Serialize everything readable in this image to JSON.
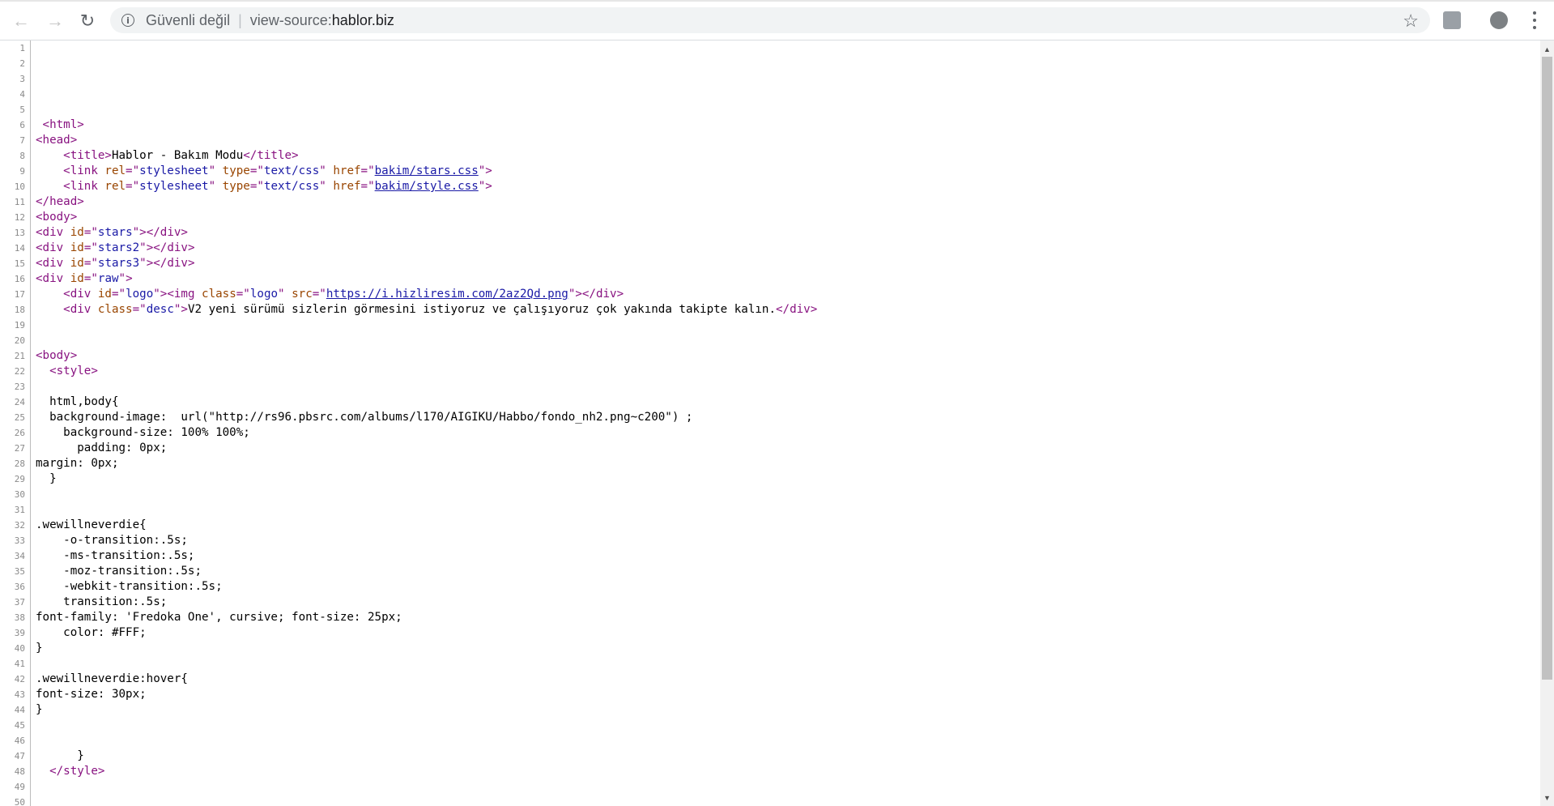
{
  "browser": {
    "security_label": "Güvenli değil",
    "separator": "|",
    "url_scheme": "view-source:",
    "url_host": "hablor.biz",
    "icons": {
      "back": "arrow-left-icon",
      "forward": "arrow-right-icon",
      "reload": "reload-icon",
      "info": "info-icon",
      "bookmark": "star-icon",
      "extension1": "extension-icon",
      "extension2": "profile-icon",
      "menu": "kebab-menu-icon"
    }
  },
  "source_lines": [
    [],
    [],
    [],
    [],
    [],
    [
      {
        "t": " "
      },
      {
        "c": "tag",
        "t": "<html>"
      }
    ],
    [
      {
        "c": "tag",
        "t": "<head>"
      }
    ],
    [
      {
        "t": "    "
      },
      {
        "c": "tag",
        "t": "<title>"
      },
      {
        "t": "Hablor - Bakım Modu"
      },
      {
        "c": "tag",
        "t": "</title>"
      }
    ],
    [
      {
        "t": "    "
      },
      {
        "c": "tag",
        "t": "<link "
      },
      {
        "c": "attr",
        "t": "rel"
      },
      {
        "c": "tag",
        "t": "=\""
      },
      {
        "c": "val",
        "t": "stylesheet"
      },
      {
        "c": "tag",
        "t": "\" "
      },
      {
        "c": "attr",
        "t": "type"
      },
      {
        "c": "tag",
        "t": "=\""
      },
      {
        "c": "val",
        "t": "text/css"
      },
      {
        "c": "tag",
        "t": "\" "
      },
      {
        "c": "attr",
        "t": "href"
      },
      {
        "c": "tag",
        "t": "=\""
      },
      {
        "c": "link",
        "t": "bakim/stars.css"
      },
      {
        "c": "tag",
        "t": "\">"
      }
    ],
    [
      {
        "t": "    "
      },
      {
        "c": "tag",
        "t": "<link "
      },
      {
        "c": "attr",
        "t": "rel"
      },
      {
        "c": "tag",
        "t": "=\""
      },
      {
        "c": "val",
        "t": "stylesheet"
      },
      {
        "c": "tag",
        "t": "\" "
      },
      {
        "c": "attr",
        "t": "type"
      },
      {
        "c": "tag",
        "t": "=\""
      },
      {
        "c": "val",
        "t": "text/css"
      },
      {
        "c": "tag",
        "t": "\" "
      },
      {
        "c": "attr",
        "t": "href"
      },
      {
        "c": "tag",
        "t": "=\""
      },
      {
        "c": "link",
        "t": "bakim/style.css"
      },
      {
        "c": "tag",
        "t": "\">"
      }
    ],
    [
      {
        "c": "tag",
        "t": "</head>"
      }
    ],
    [
      {
        "c": "tag",
        "t": "<body>"
      }
    ],
    [
      {
        "c": "tag",
        "t": "<div "
      },
      {
        "c": "attr",
        "t": "id"
      },
      {
        "c": "tag",
        "t": "=\""
      },
      {
        "c": "val",
        "t": "stars"
      },
      {
        "c": "tag",
        "t": "\"></div>"
      }
    ],
    [
      {
        "c": "tag",
        "t": "<div "
      },
      {
        "c": "attr",
        "t": "id"
      },
      {
        "c": "tag",
        "t": "=\""
      },
      {
        "c": "val",
        "t": "stars2"
      },
      {
        "c": "tag",
        "t": "\"></div>"
      }
    ],
    [
      {
        "c": "tag",
        "t": "<div "
      },
      {
        "c": "attr",
        "t": "id"
      },
      {
        "c": "tag",
        "t": "=\""
      },
      {
        "c": "val",
        "t": "stars3"
      },
      {
        "c": "tag",
        "t": "\"></div>"
      }
    ],
    [
      {
        "c": "tag",
        "t": "<div "
      },
      {
        "c": "attr",
        "t": "id"
      },
      {
        "c": "tag",
        "t": "=\""
      },
      {
        "c": "val",
        "t": "raw"
      },
      {
        "c": "tag",
        "t": "\">"
      }
    ],
    [
      {
        "t": "    "
      },
      {
        "c": "tag",
        "t": "<div "
      },
      {
        "c": "attr",
        "t": "id"
      },
      {
        "c": "tag",
        "t": "=\""
      },
      {
        "c": "val",
        "t": "logo"
      },
      {
        "c": "tag",
        "t": "\"><img "
      },
      {
        "c": "attr",
        "t": "class"
      },
      {
        "c": "tag",
        "t": "=\""
      },
      {
        "c": "val",
        "t": "logo"
      },
      {
        "c": "tag",
        "t": "\" "
      },
      {
        "c": "attr",
        "t": "src"
      },
      {
        "c": "tag",
        "t": "=\""
      },
      {
        "c": "link",
        "t": "https://i.hizliresim.com/2az2Qd.png"
      },
      {
        "c": "tag",
        "t": "\"></div>"
      }
    ],
    [
      {
        "t": "    "
      },
      {
        "c": "tag",
        "t": "<div "
      },
      {
        "c": "attr",
        "t": "class"
      },
      {
        "c": "tag",
        "t": "=\""
      },
      {
        "c": "val",
        "t": "desc"
      },
      {
        "c": "tag",
        "t": "\">"
      },
      {
        "t": "V2 yeni sürümü sizlerin görmesini istiyoruz ve çalışıyoruz çok yakında takipte kalın."
      },
      {
        "c": "tag",
        "t": "</div>"
      }
    ],
    [],
    [],
    [
      {
        "c": "tag",
        "t": "<body>"
      }
    ],
    [
      {
        "t": "  "
      },
      {
        "c": "tag",
        "t": "<style>"
      }
    ],
    [],
    [
      {
        "t": "  html,body{"
      }
    ],
    [
      {
        "t": "  background-image:  url(\"http://rs96.pbsrc.com/albums/l170/AIGIKU/Habbo/fondo_nh2.png~c200\") ;"
      }
    ],
    [
      {
        "t": "    background-size: 100% 100%;"
      }
    ],
    [
      {
        "t": "      padding: 0px;"
      }
    ],
    [
      {
        "t": "margin: 0px;"
      }
    ],
    [
      {
        "t": "  }"
      }
    ],
    [],
    [],
    [
      {
        "t": ".wewillneverdie{"
      }
    ],
    [
      {
        "t": "    -o-transition:.5s;"
      }
    ],
    [
      {
        "t": "    -ms-transition:.5s;"
      }
    ],
    [
      {
        "t": "    -moz-transition:.5s;"
      }
    ],
    [
      {
        "t": "    -webkit-transition:.5s;"
      }
    ],
    [
      {
        "t": "    transition:.5s;"
      }
    ],
    [
      {
        "t": "font-family: 'Fredoka One', cursive; font-size: 25px;"
      }
    ],
    [
      {
        "t": "    color: #FFF;"
      }
    ],
    [
      {
        "t": "}"
      }
    ],
    [],
    [
      {
        "t": ".wewillneverdie:hover{"
      }
    ],
    [
      {
        "t": "font-size: 30px;"
      }
    ],
    [
      {
        "t": "}"
      }
    ],
    [],
    [],
    [
      {
        "t": "      }"
      }
    ],
    [
      {
        "t": "  "
      },
      {
        "c": "tag",
        "t": "</style>"
      }
    ],
    [],
    []
  ],
  "line_numbers": [
    "1",
    "2",
    "3",
    "4",
    "5",
    "6",
    "7",
    "8",
    "9",
    "10",
    "11",
    "12",
    "13",
    "14",
    "15",
    "16",
    "17",
    "18",
    "19",
    "20",
    "21",
    "22",
    "23",
    "24",
    "25",
    "26",
    "27",
    "28",
    "29",
    "30",
    "31",
    "32",
    "33",
    "34",
    "35",
    "36",
    "37",
    "38",
    "39",
    "40",
    "41",
    "42",
    "43",
    "44",
    "45",
    "46",
    "47",
    "48",
    "49",
    "50"
  ],
  "colors": {
    "tag": "#881280",
    "attribute": "#994500",
    "value": "#1a1aa6",
    "link": "#1a1aa6"
  },
  "scrollbar": {
    "position": 0,
    "visible_fraction": 0.85
  }
}
